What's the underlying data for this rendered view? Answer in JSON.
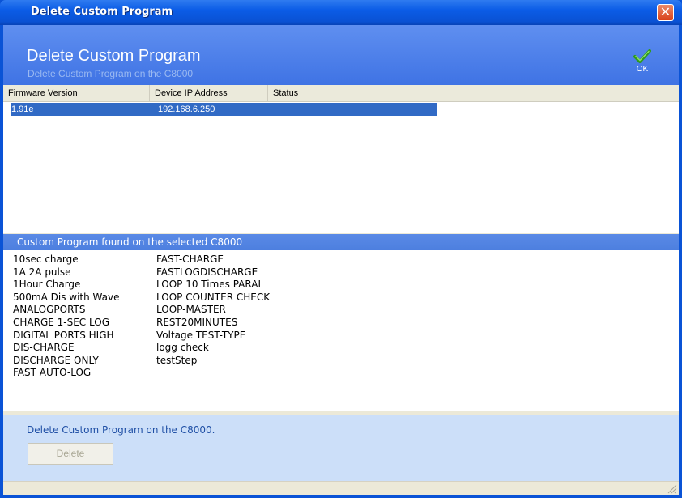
{
  "window": {
    "title": "Delete Custom Program",
    "close_glyph": "✕"
  },
  "banner": {
    "title": "Delete Custom Program",
    "subtitle": "Delete Custom Program on the C8000",
    "ok_label": "OK",
    "ok_icon": "check-icon",
    "ok_color": "#3fae2a"
  },
  "device_list": {
    "columns": [
      "Firmware Version",
      "Device IP Address",
      "Status"
    ],
    "rows": [
      {
        "firmware": "1.91e",
        "ip": "192.168.6.250",
        "status": ""
      }
    ],
    "selected_color": "#316ac5"
  },
  "programs": {
    "header": "Custom Program found on the selected C8000",
    "column1": [
      "10sec charge",
      "1A 2A pulse",
      "1Hour Charge",
      "500mA Dis with Wave",
      "ANALOGPORTS",
      "CHARGE 1-SEC LOG",
      "DIGITAL PORTS HIGH",
      "DIS-CHARGE",
      "DISCHARGE ONLY",
      "FAST AUTO-LOG"
    ],
    "column2": [
      "FAST-CHARGE",
      "FASTLOGDISCHARGE",
      "LOOP 10 Times PARAL",
      "LOOP COUNTER CHECK",
      "LOOP-MASTER",
      "REST20MINUTES",
      "Voltage TEST-TYPE",
      "logg check",
      "testStep"
    ]
  },
  "footer": {
    "message": "Delete Custom Program on the C8000.",
    "delete_label": "Delete"
  },
  "colors": {
    "titlebar": "#0a53d6",
    "banner": "#4a7de6",
    "footer_panel": "#ccdff9"
  }
}
